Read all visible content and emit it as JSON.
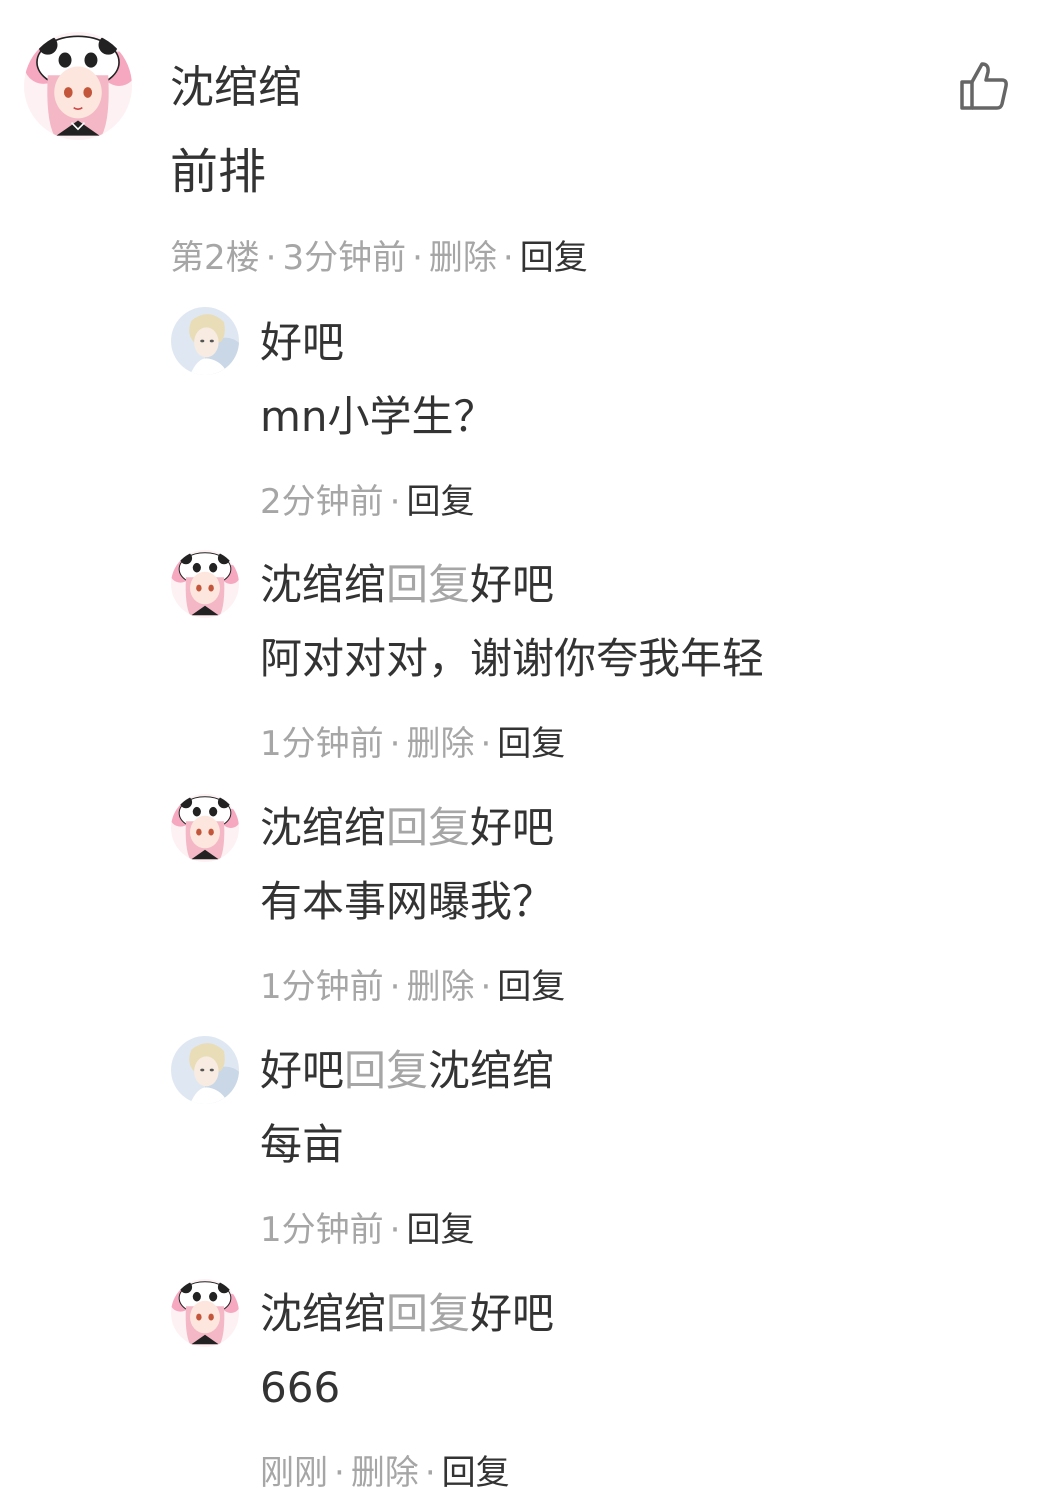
{
  "comment": {
    "author": "沈绾绾",
    "content": "前排",
    "floor": "第2楼",
    "time": "3分钟前",
    "delete_label": "删除",
    "reply_label": "回复",
    "like_icon": "thumbs-up-icon"
  },
  "replies": [
    {
      "author": "好吧",
      "reply_word": "",
      "target": "",
      "content": "mn小学生？",
      "time": "2分钟前",
      "delete_label": "",
      "reply_label": "回复"
    },
    {
      "author": "沈绾绾",
      "reply_word": "回复",
      "target": "好吧",
      "content": "阿对对对，谢谢你夸我年轻",
      "time": "1分钟前",
      "delete_label": "删除",
      "reply_label": "回复"
    },
    {
      "author": "沈绾绾",
      "reply_word": "回复",
      "target": "好吧",
      "content": "有本事网曝我？",
      "time": "1分钟前",
      "delete_label": "删除",
      "reply_label": "回复"
    },
    {
      "author": "好吧",
      "reply_word": "回复",
      "target": "沈绾绾",
      "content": "每亩",
      "time": "1分钟前",
      "delete_label": "",
      "reply_label": "回复"
    },
    {
      "author": "沈绾绾",
      "reply_word": "回复",
      "target": "好吧",
      "content": "666",
      "time": "刚刚",
      "delete_label": "删除",
      "reply_label": "回复"
    }
  ],
  "sep": "·",
  "colors": {
    "text": "#333333",
    "muted": "#a6a6a6",
    "background": "#ffffff"
  }
}
